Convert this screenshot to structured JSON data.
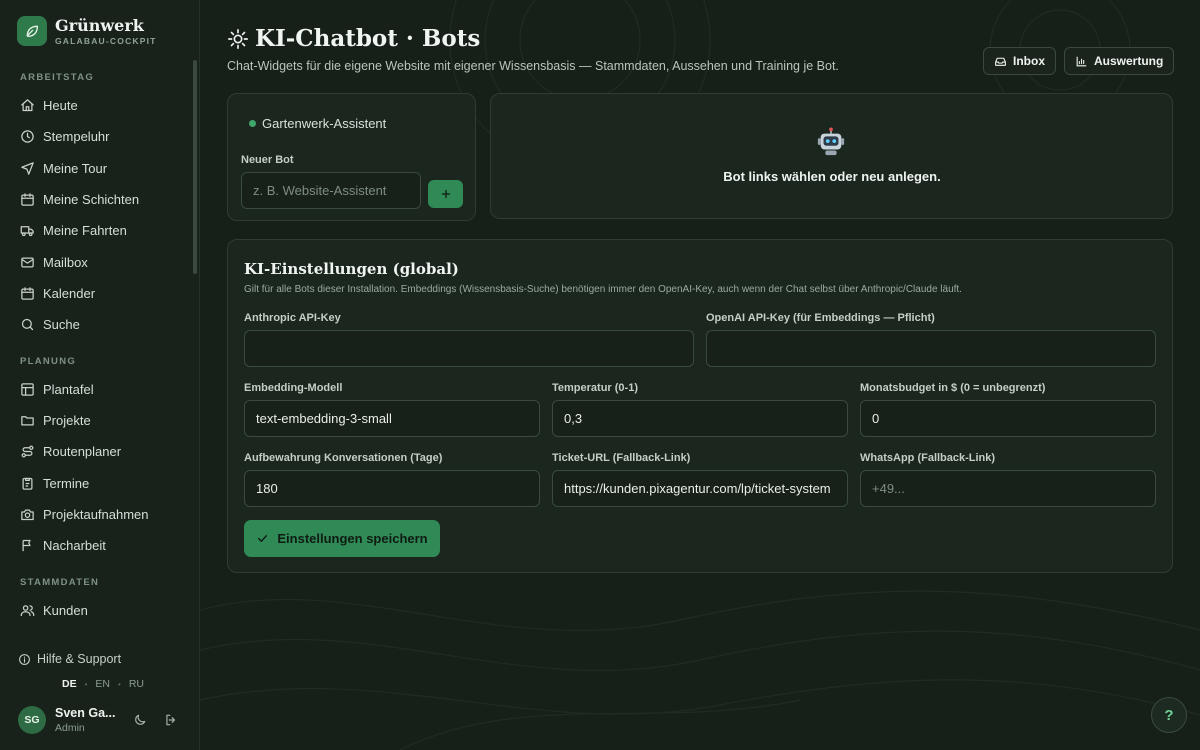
{
  "brand": {
    "name": "Grünwerk",
    "subtitle": "GALABAU-COCKPIT"
  },
  "sidebar": {
    "sections": [
      {
        "label": "ARBEITSTAG",
        "items": [
          {
            "label": "Heute",
            "icon": "home-icon"
          },
          {
            "label": "Stempeluhr",
            "icon": "clock-icon"
          },
          {
            "label": "Meine Tour",
            "icon": "navigation-icon"
          },
          {
            "label": "Meine Schichten",
            "icon": "calendar-icon"
          },
          {
            "label": "Meine Fahrten",
            "icon": "truck-icon"
          },
          {
            "label": "Mailbox",
            "icon": "mail-icon"
          },
          {
            "label": "Kalender",
            "icon": "calendar-icon"
          },
          {
            "label": "Suche",
            "icon": "search-icon"
          }
        ]
      },
      {
        "label": "PLANUNG",
        "items": [
          {
            "label": "Plantafel",
            "icon": "board-icon"
          },
          {
            "label": "Projekte",
            "icon": "folder-icon"
          },
          {
            "label": "Routenplaner",
            "icon": "route-icon"
          },
          {
            "label": "Termine",
            "icon": "clipboard-icon"
          },
          {
            "label": "Projektaufnahmen",
            "icon": "camera-icon"
          },
          {
            "label": "Nacharbeit",
            "icon": "flag-icon"
          }
        ]
      },
      {
        "label": "STAMMDATEN",
        "items": [
          {
            "label": "Kunden",
            "icon": "users-icon"
          }
        ]
      }
    ],
    "help_label": "Hilfe & Support",
    "languages": [
      "DE",
      "EN",
      "RU"
    ],
    "active_language": "DE",
    "user": {
      "initials": "SG",
      "name": "Sven Ga...",
      "role": "Admin"
    }
  },
  "header": {
    "title": "KI-Chatbot · Bots",
    "subtitle": "Chat-Widgets für die eigene Website mit eigener Wissensbasis — Stammdaten, Aussehen und Training je Bot.",
    "inbox_label": "Inbox",
    "analytics_label": "Auswertung"
  },
  "bots": {
    "list": [
      {
        "name": "Gartenwerk-Assistent",
        "status_color": "#3fa66a"
      }
    ],
    "new_label": "Neuer Bot",
    "new_placeholder": "z. B. Website-Assistent",
    "add_label": "+"
  },
  "detail": {
    "empty_text": "Bot links wählen oder neu anlegen."
  },
  "settings": {
    "title": "KI-Einstellungen (global)",
    "description": "Gilt für alle Bots dieser Installation. Embeddings (Wissensbasis-Suche) benötigen immer den OpenAI-Key, auch wenn der Chat selbst über Anthropic/Claude läuft.",
    "anthropic": {
      "label": "Anthropic API-Key",
      "value": ""
    },
    "openai": {
      "label": "OpenAI API-Key (für Embeddings — Pflicht)",
      "value": ""
    },
    "embedding": {
      "label": "Embedding-Modell",
      "value": "text-embedding-3-small"
    },
    "temperature": {
      "label": "Temperatur (0-1)",
      "value": "0,3"
    },
    "budget": {
      "label": "Monatsbudget in $ (0 = unbegrenzt)",
      "value": "0"
    },
    "retention": {
      "label": "Aufbewahrung Konversationen (Tage)",
      "value": "180"
    },
    "ticket": {
      "label": "Ticket-URL (Fallback-Link)",
      "value": "https://kunden.pixagentur.com/lp/ticket-system"
    },
    "whatsapp": {
      "label": "WhatsApp (Fallback-Link)",
      "value": "",
      "placeholder": "+49..."
    },
    "save_label": "Einstellungen speichern"
  },
  "fab_label": "?",
  "colors": {
    "accent": "#2f8a55",
    "background": "#162019",
    "sidebar": "#18221b"
  }
}
